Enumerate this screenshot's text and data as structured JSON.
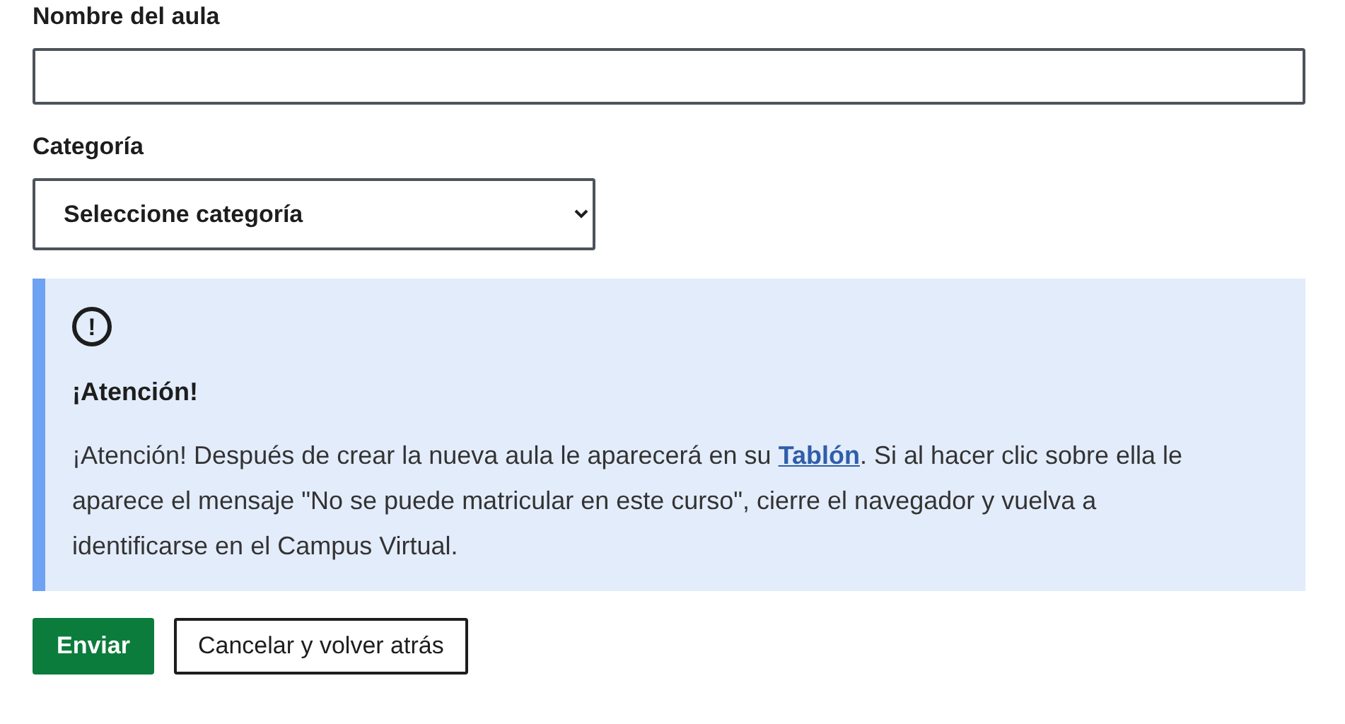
{
  "fields": [
    {
      "kind": "text",
      "label": "Nombre del aula"
    },
    {
      "kind": "select",
      "label": "Categoría",
      "value": "Seleccione categoría"
    }
  ],
  "alert": {
    "icon": "!",
    "title": "¡Atención!",
    "text_before": "¡Atención! Después de crear la nueva aula le aparecerá en su ",
    "link": "Tablón",
    "text_after": ". Si al hacer clic sobre ella le aparece el mensaje \"No se puede matricular en este curso\", cierre el navegador y vuelva a identificarse en el Campus Virtual."
  },
  "buttons": [
    {
      "kind": "primary",
      "label": "Enviar"
    },
    {
      "kind": "secondary",
      "label": "Cancelar y volver atrás"
    }
  ]
}
